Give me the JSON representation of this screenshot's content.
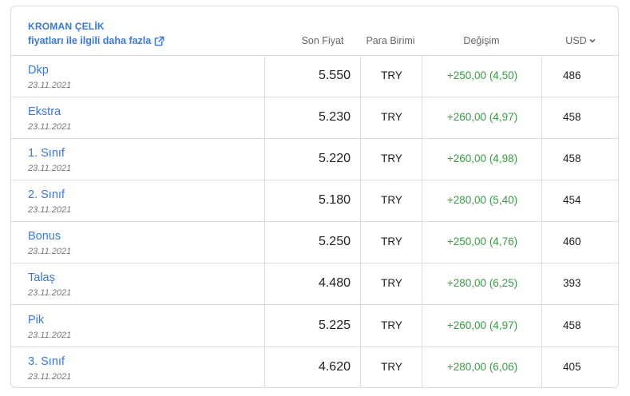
{
  "header": {
    "brand": "KROMAN ÇELİK",
    "more_link": "fiyatları ile ilgili daha fazla",
    "columns": {
      "price": "Son Fiyat",
      "currency": "Para Birimi",
      "change": "Değişim",
      "usd": "USD"
    }
  },
  "rows": [
    {
      "name": "Dkp",
      "date": "23.11.2021",
      "price": "5.550",
      "currency": "TRY",
      "change": "+250,00 (4,50)",
      "usd": "486"
    },
    {
      "name": "Ekstra",
      "date": "23.11.2021",
      "price": "5.230",
      "currency": "TRY",
      "change": "+260,00 (4,97)",
      "usd": "458"
    },
    {
      "name": "1. Sınıf",
      "date": "23.11.2021",
      "price": "5.220",
      "currency": "TRY",
      "change": "+260,00 (4,98)",
      "usd": "458"
    },
    {
      "name": "2. Sınıf",
      "date": "23.11.2021",
      "price": "5.180",
      "currency": "TRY",
      "change": "+280,00 (5,40)",
      "usd": "454"
    },
    {
      "name": "Bonus",
      "date": "23.11.2021",
      "price": "5.250",
      "currency": "TRY",
      "change": "+250,00 (4,76)",
      "usd": "460"
    },
    {
      "name": "Talaş",
      "date": "23.11.2021",
      "price": "4.480",
      "currency": "TRY",
      "change": "+280,00 (6,25)",
      "usd": "393"
    },
    {
      "name": "Pik",
      "date": "23.11.2021",
      "price": "5.225",
      "currency": "TRY",
      "change": "+260,00 (4,97)",
      "usd": "458"
    },
    {
      "name": "3. Sınıf",
      "date": "23.11.2021",
      "price": "4.620",
      "currency": "TRY",
      "change": "+280,00 (6,06)",
      "usd": "405"
    }
  ],
  "colors": {
    "link": "#3b78d8",
    "positive": "#3a9d46",
    "border": "#dcdcdc"
  },
  "icons": {
    "more_link": "external-link-icon",
    "usd": "chevron-down-icon"
  }
}
